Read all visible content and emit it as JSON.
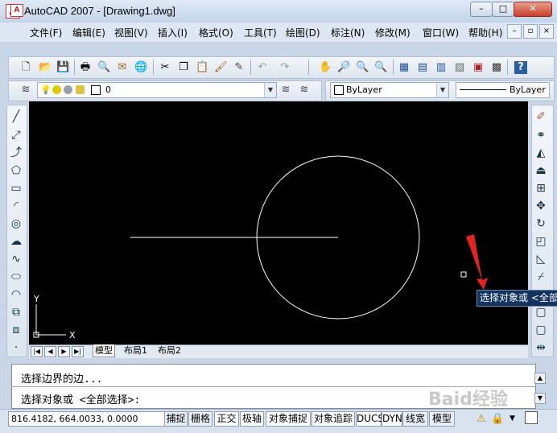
{
  "window": {
    "title": "AutoCAD 2007 - [Drawing1.dwg]",
    "minimize_glyph": "–",
    "maximize_glyph": "□",
    "close_glyph": "✕",
    "mdi_min_glyph": "–",
    "mdi_restore_glyph": "▫",
    "mdi_close_glyph": "×"
  },
  "menu": {
    "items": [
      {
        "label": "文件(F)"
      },
      {
        "label": "编辑(E)"
      },
      {
        "label": "视图(V)"
      },
      {
        "label": "插入(I)"
      },
      {
        "label": "格式(O)"
      },
      {
        "label": "工具(T)"
      },
      {
        "label": "绘图(D)"
      },
      {
        "label": "标注(N)"
      },
      {
        "label": "修改(M)"
      },
      {
        "label": "窗口(W)"
      },
      {
        "label": "帮助(H)"
      }
    ]
  },
  "layers": {
    "current_layer": "0",
    "color_combo": "ByLayer",
    "linetype_combo": "ByLayer"
  },
  "canvas": {
    "ucs_x_label": "X",
    "ucs_y_label": "Y",
    "tooltip_text": "选择对象或 <全部选择>:"
  },
  "tabs": {
    "nav": [
      "|◀",
      "◀",
      "▶",
      "▶|"
    ],
    "items": [
      "模型",
      "布局1",
      "布局2"
    ]
  },
  "command": {
    "line1": "选择边界的边...",
    "line2": "选择对象或 <全部选择>:"
  },
  "status": {
    "coordinates": "816.4182, 664.0033, 0.0000",
    "buttons": [
      "捕捉",
      "栅格",
      "正交",
      "极轴",
      "对象捕捉",
      "对象追踪",
      "DUCS",
      "DYN",
      "线宽",
      "模型"
    ]
  },
  "watermark": "Baid经验",
  "colors": {
    "canvas_bg": "#000000",
    "drawing_lines": "#ffffff",
    "arrow": "#e02424",
    "tooltip_bg": "#14325e"
  }
}
